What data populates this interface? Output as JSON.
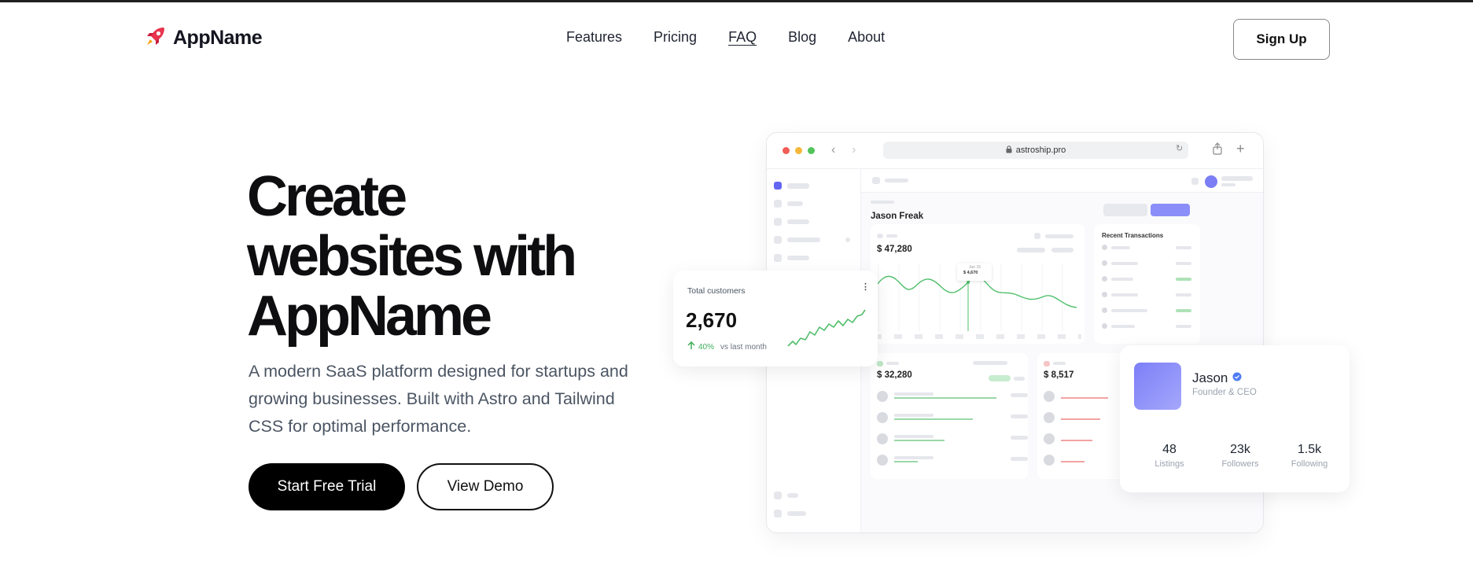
{
  "header": {
    "app_name": "AppName",
    "nav": [
      "Features",
      "Pricing",
      "FAQ",
      "Blog",
      "About"
    ],
    "signup_label": "Sign Up"
  },
  "hero": {
    "title_line1": "Create",
    "title_line2": "websites with",
    "title_line3": "AppName",
    "subtitle": "A modern SaaS platform designed for startups and growing businesses. Built with Astro and Tailwind CSS for optimal performance.",
    "primary_cta": "Start Free Trial",
    "secondary_cta": "View Demo"
  },
  "browser": {
    "url": "astroship.pro",
    "dashboard_user": "Jason Freak",
    "main_amount": "$ 47,280",
    "tooltip_date": "Jun 15",
    "tooltip_value": "$ 4,670",
    "recent_transactions_label": "Recent Transactions",
    "card2_amount": "$ 32,280",
    "card3_amount": "$ 8,517"
  },
  "customers_card": {
    "label": "Total customers",
    "value": "2,670",
    "change": "40%",
    "change_note": "vs last month"
  },
  "profile_card": {
    "name": "Jason",
    "role": "Founder & CEO",
    "stats": [
      {
        "value": "48",
        "label": "Listings"
      },
      {
        "value": "23k",
        "label": "Followers"
      },
      {
        "value": "1.5k",
        "label": "Following"
      }
    ]
  },
  "colors": {
    "accent": "#6366f1",
    "chart_line": "#4fbf6a",
    "primary_button": "#000000",
    "mac_red": "#f05d56",
    "mac_yellow": "#f5b83a",
    "mac_green": "#52c45a"
  },
  "icons": [
    "rocket-icon",
    "lock-icon",
    "reload-icon",
    "share-icon",
    "plus-icon",
    "chevron-left-icon",
    "chevron-right-icon",
    "arrow-up-icon",
    "verified-icon",
    "more-icon"
  ]
}
